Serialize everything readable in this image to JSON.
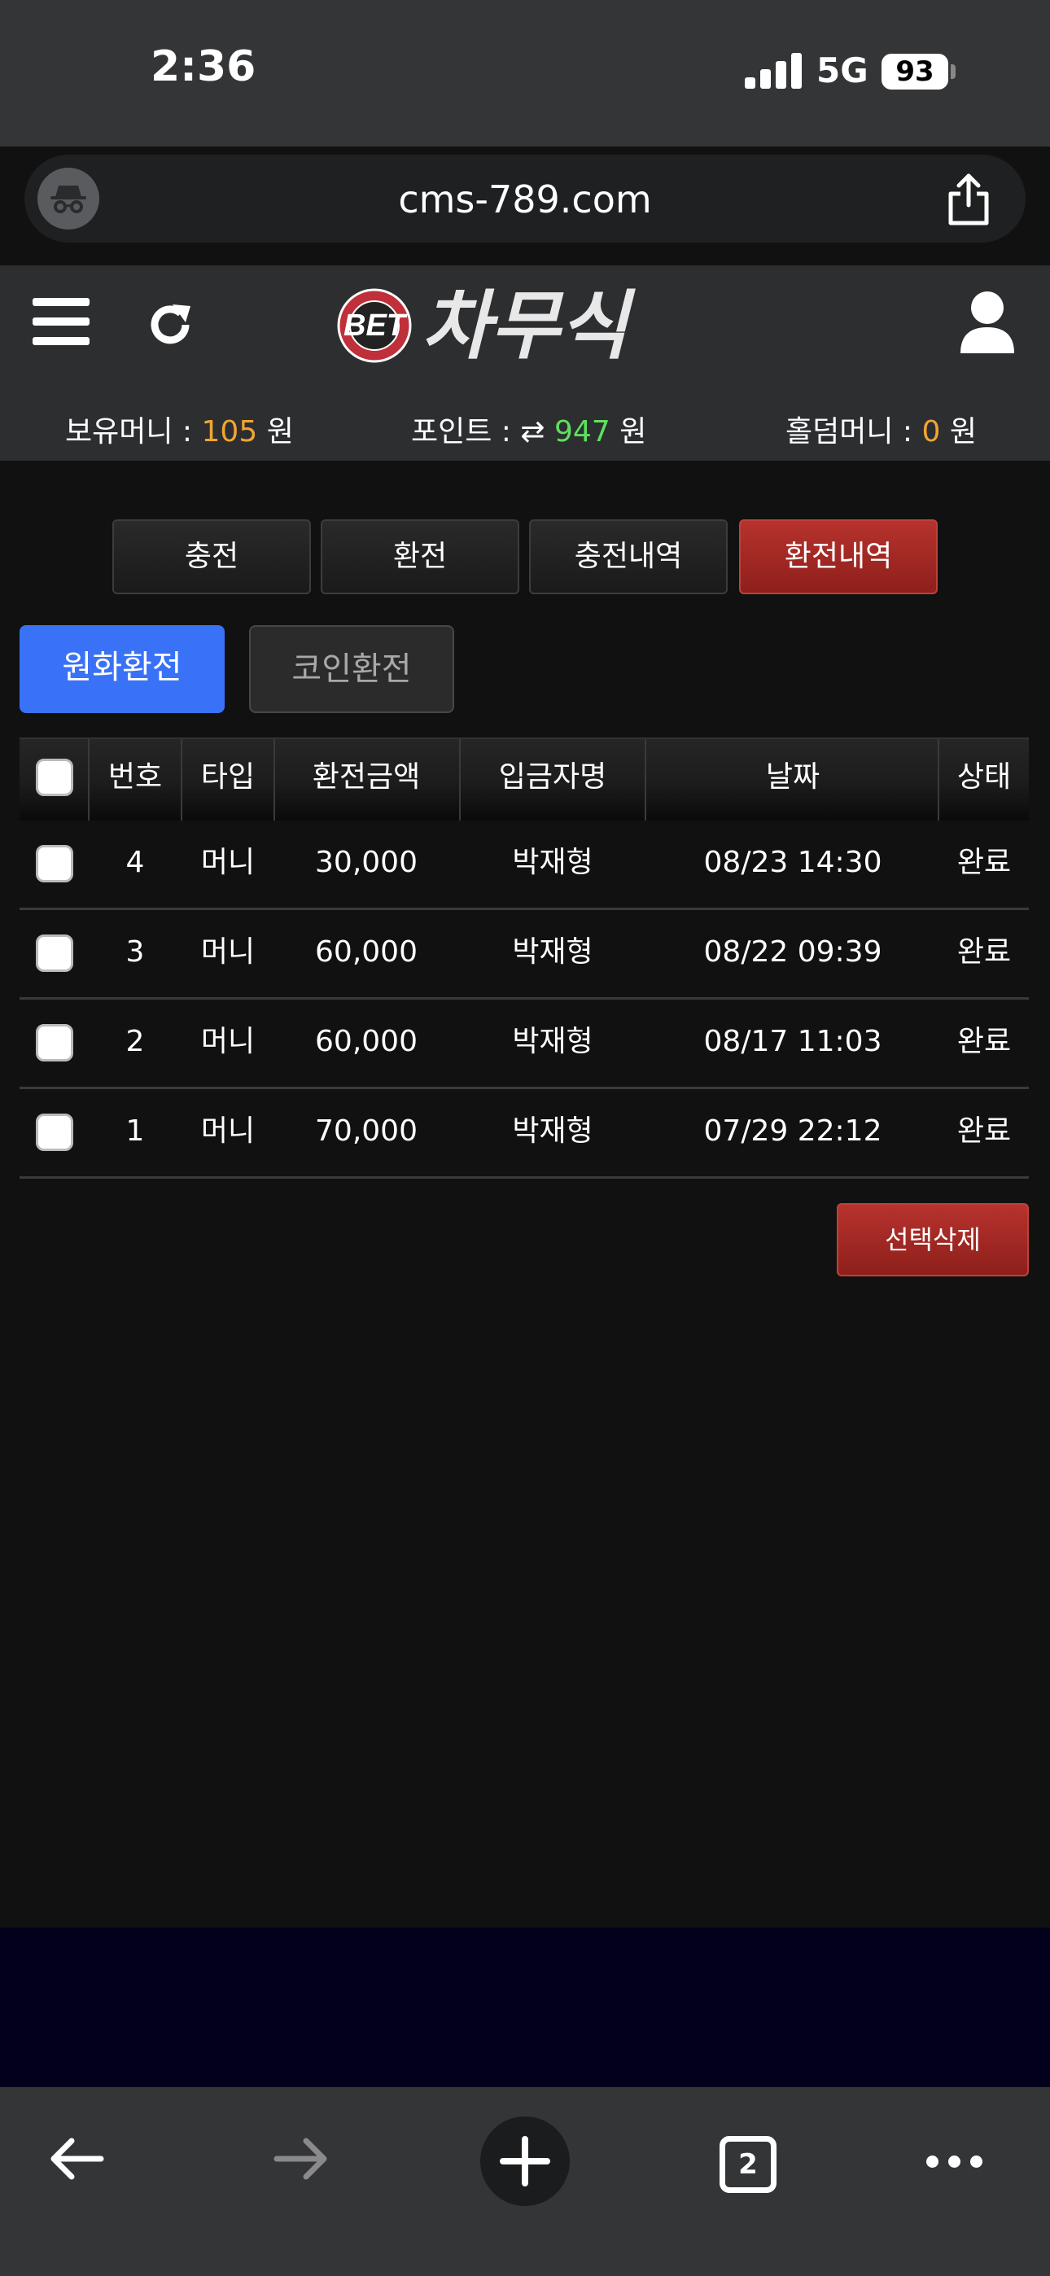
{
  "status_bar": {
    "time": "2:36",
    "network": "5G",
    "battery": "93"
  },
  "browser": {
    "url": "cms-789.com",
    "tab_count": "2"
  },
  "site": {
    "logo_prefix": "BET",
    "logo_text": "차무식",
    "balances": {
      "money_label": "보유머니 :",
      "money_value": "105",
      "money_unit": "원",
      "point_label": "포인트 :",
      "point_value": "947",
      "point_unit": "원",
      "holdem_label": "홀덤머니 :",
      "holdem_value": "0",
      "holdem_unit": "원"
    }
  },
  "tabs": [
    {
      "label": "충전",
      "active": false
    },
    {
      "label": "환전",
      "active": false
    },
    {
      "label": "충전내역",
      "active": false
    },
    {
      "label": "환전내역",
      "active": true
    }
  ],
  "subtabs": [
    {
      "label": "원화환전",
      "active": true
    },
    {
      "label": "코인환전",
      "active": false
    }
  ],
  "table": {
    "headers": [
      "번호",
      "타입",
      "환전금액",
      "입금자명",
      "날짜",
      "상태"
    ],
    "rows": [
      {
        "no": "4",
        "type": "머니",
        "amount": "30,000",
        "name": "박재형",
        "date": "08/23 14:30",
        "status": "완료"
      },
      {
        "no": "3",
        "type": "머니",
        "amount": "60,000",
        "name": "박재형",
        "date": "08/22 09:39",
        "status": "완료"
      },
      {
        "no": "2",
        "type": "머니",
        "amount": "60,000",
        "name": "박재형",
        "date": "08/17 11:03",
        "status": "완료"
      },
      {
        "no": "1",
        "type": "머니",
        "amount": "70,000",
        "name": "박재형",
        "date": "07/29 22:12",
        "status": "완료"
      }
    ]
  },
  "delete_button": "선택삭제",
  "colors": {
    "accent_red": "#a82a25",
    "accent_blue": "#3a72f7",
    "orange": "#f0a532",
    "green": "#5ee05e"
  }
}
